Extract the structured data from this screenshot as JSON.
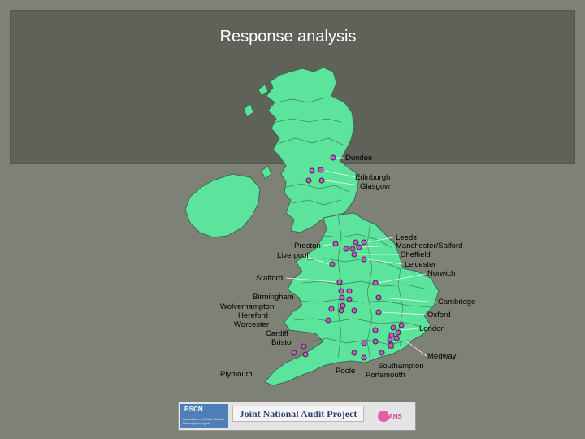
{
  "title": "Response analysis",
  "colors": {
    "land": "#5ce49c",
    "border": "#3a6b50",
    "marker_fill": "#c35ac8",
    "marker_stroke": "#3a2a42",
    "background": "#7d8176",
    "panel": "#5f6259"
  },
  "cities": {
    "dundee": "Dundee",
    "edinburgh": "Edinburgh",
    "glasgow": "Glasgow",
    "leeds": "Leeds",
    "manchester_salford": "Manchester/Salford",
    "sheffield": "Sheffield",
    "leicester": "Leicester",
    "norwich": "Norwich",
    "preston": "Preston",
    "liverpool": "Liverpool",
    "stafford": "Stafford",
    "birmingham": "Birmingham",
    "wolverhampton": "Wolverhampton",
    "hereford": "Hereford",
    "worcester": "Worcester",
    "cardiff": "Cardiff",
    "bristol": "Bristol",
    "cambridge": "Cambridge",
    "oxford": "Oxford",
    "london": "London",
    "medway": "Medway",
    "southampton": "Southampton",
    "portsmouth": "Portsmouth",
    "poole": "Poole",
    "plymouth": "Plymouth"
  },
  "footer": {
    "left_logo_text": "BSCN",
    "left_logo_subtext": "Association of British Clinical Neurophysiologists",
    "center_text": "Joint National Audit Project",
    "right_logo_text": "ANS"
  }
}
